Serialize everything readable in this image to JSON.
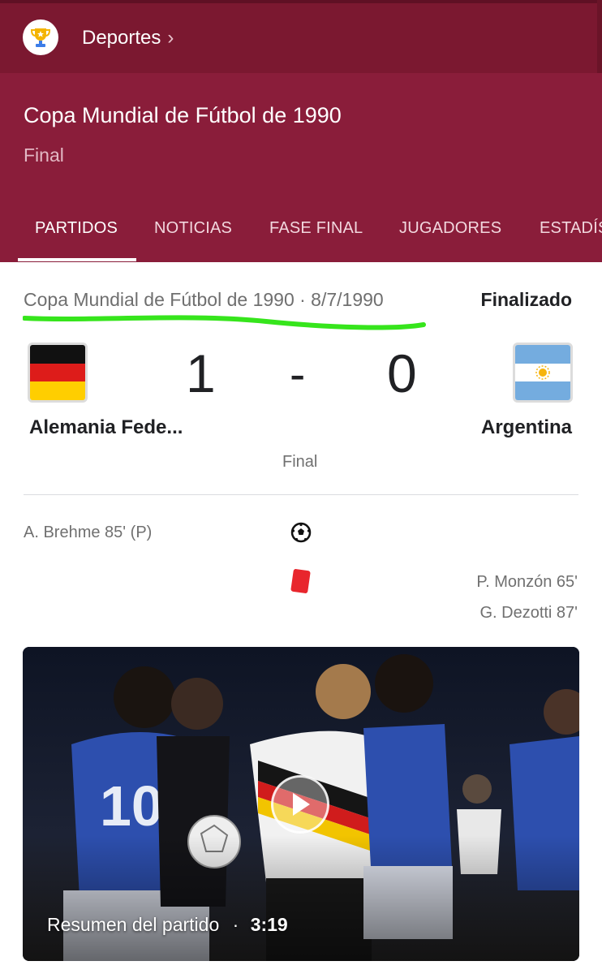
{
  "topbar": {
    "breadcrumb": "Deportes",
    "logo_icon": "trophy-icon"
  },
  "header": {
    "title": "Copa Mundial de Fútbol de 1990",
    "subtitle": "Final"
  },
  "tabs": [
    {
      "label": "PARTIDOS",
      "active": true
    },
    {
      "label": "NOTICIAS",
      "active": false
    },
    {
      "label": "FASE FINAL",
      "active": false
    },
    {
      "label": "JUGADORES",
      "active": false
    },
    {
      "label": "ESTADÍS",
      "active": false
    }
  ],
  "match": {
    "competition_date": "Copa Mundial de Fútbol de 1990 · 8/7/1990",
    "status": "Finalizado",
    "home": {
      "name": "Alemania Fede...",
      "score": "1",
      "flag_icon": "west-germany-flag-icon"
    },
    "separator": "-",
    "away": {
      "name": "Argentina",
      "score": "0",
      "flag_icon": "argentina-flag-icon"
    },
    "stage": "Final"
  },
  "events": {
    "home": [
      {
        "text": "A. Brehme 85' (P)",
        "icon": "soccer-ball-icon"
      }
    ],
    "away": [
      {
        "text": "P. Monzón 65'",
        "icon": "red-card-icon"
      },
      {
        "text": "G. Dezotti 87'"
      }
    ]
  },
  "video": {
    "title": "Resumen del partido",
    "separator": "·",
    "duration": "3:19"
  },
  "colors": {
    "topbar": "#7b1830",
    "header": "#8a1d3a",
    "highlight": "#36e51c",
    "red_card": "#e8262d"
  }
}
